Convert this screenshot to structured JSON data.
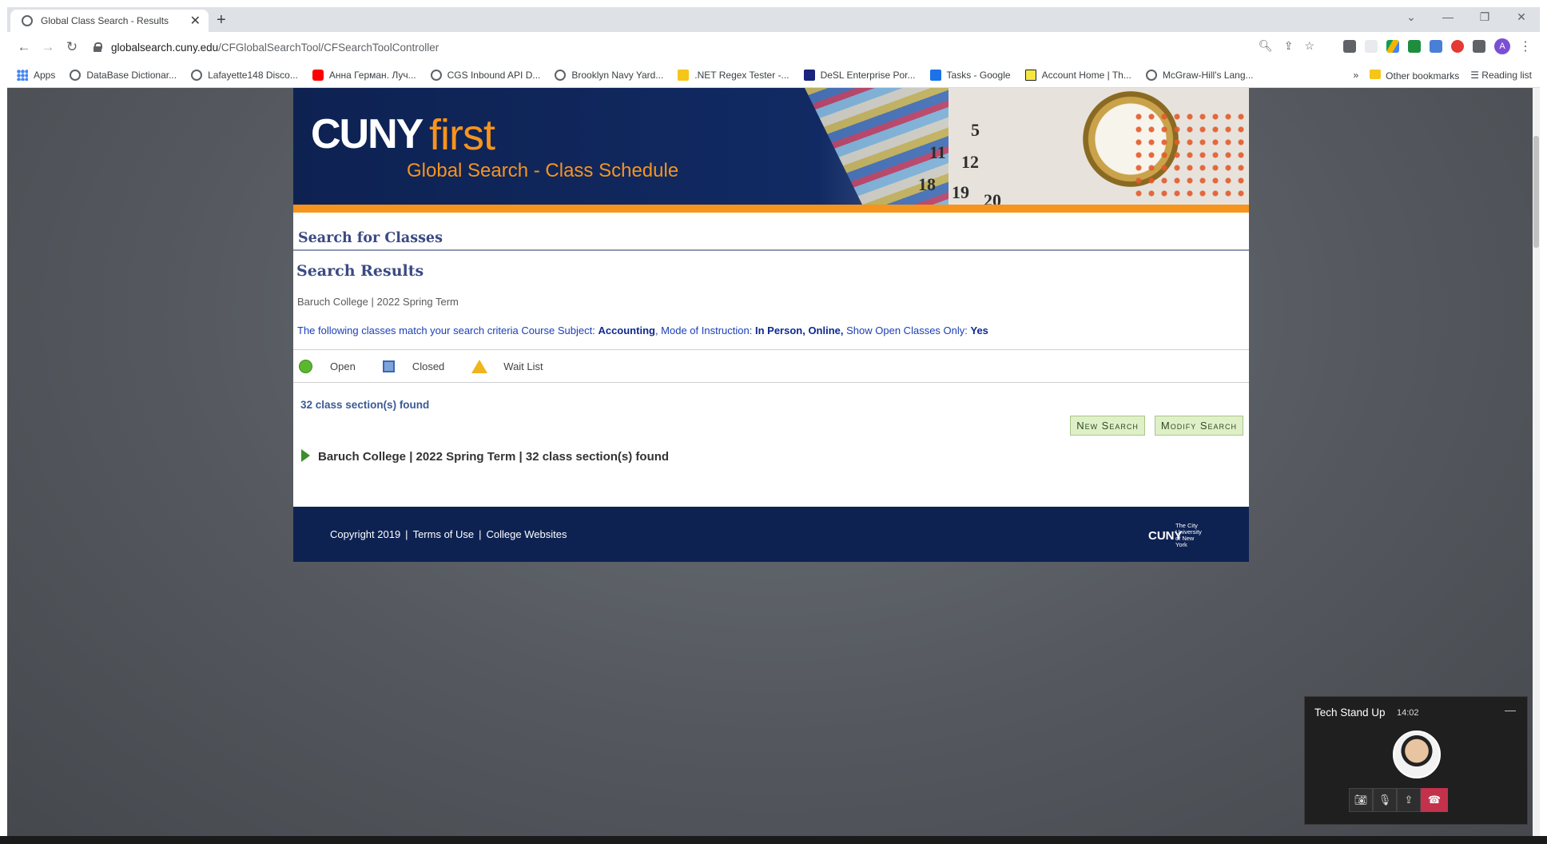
{
  "browser": {
    "tab_title": "Global Class Search - Results",
    "url_host": "globalsearch.cuny.edu",
    "url_path": "/CFGlobalSearchTool/CFSearchToolController",
    "bookmarks": [
      {
        "label": "Apps",
        "color": "#4285f4"
      },
      {
        "label": "DataBase Dictionar...",
        "color": "#5f6368"
      },
      {
        "label": "Lafayette148 Disco...",
        "color": "#5f6368"
      },
      {
        "label": "Анна Герман. Луч...",
        "color": "#ff0000"
      },
      {
        "label": "CGS Inbound API D...",
        "color": "#5f6368"
      },
      {
        "label": "Brooklyn Navy Yard...",
        "color": "#5f6368"
      },
      {
        "label": ".NET Regex Tester -...",
        "color": "#f5c518"
      },
      {
        "label": "DeSL Enterprise Por...",
        "color": "#1a237e"
      },
      {
        "label": "Tasks - Google",
        "color": "#1a73e8"
      },
      {
        "label": "Account Home | Th...",
        "color": "#222222"
      },
      {
        "label": "McGraw-Hill's Lang...",
        "color": "#5f6368"
      }
    ],
    "overflow": "»",
    "other_bookmarks": "Other bookmarks",
    "reading_list": "Reading list",
    "profile_initial": "A"
  },
  "banner": {
    "brand_cuny": "CUNY",
    "brand_first": "first",
    "subtitle": "Global Search - Class Schedule",
    "calendar_numbers": [
      "5",
      "11",
      "12",
      "18",
      "19",
      "20"
    ]
  },
  "page": {
    "section_title": "Search for Classes",
    "results_title": "Search Results",
    "term": "Baruch College | 2022 Spring Term",
    "criteria_prefix": "The following classes match your search criteria Course Subject:",
    "criteria_subject": "Accounting",
    "criteria_mode_label": ", Mode of Instruction:",
    "criteria_mode": "In Person, Online,",
    "criteria_open_label": "Show Open Classes Only:",
    "criteria_open": "Yes",
    "legend": {
      "open": "Open",
      "closed": "Closed",
      "waitlist": "Wait List"
    },
    "found_count": "32 class section(s) found",
    "new_search": "New Search",
    "modify_search": "Modify Search",
    "group_header": "Baruch College | 2022 Spring Term | 32 class section(s) found"
  },
  "footer": {
    "copyright": "Copyright 2019",
    "terms": "Terms of Use",
    "colleges": "College Websites",
    "sep": "|",
    "logo_mark": "CUNY",
    "logo_text": "The City University of New York"
  },
  "call": {
    "title": "Tech Stand Up",
    "time": "14:02"
  }
}
